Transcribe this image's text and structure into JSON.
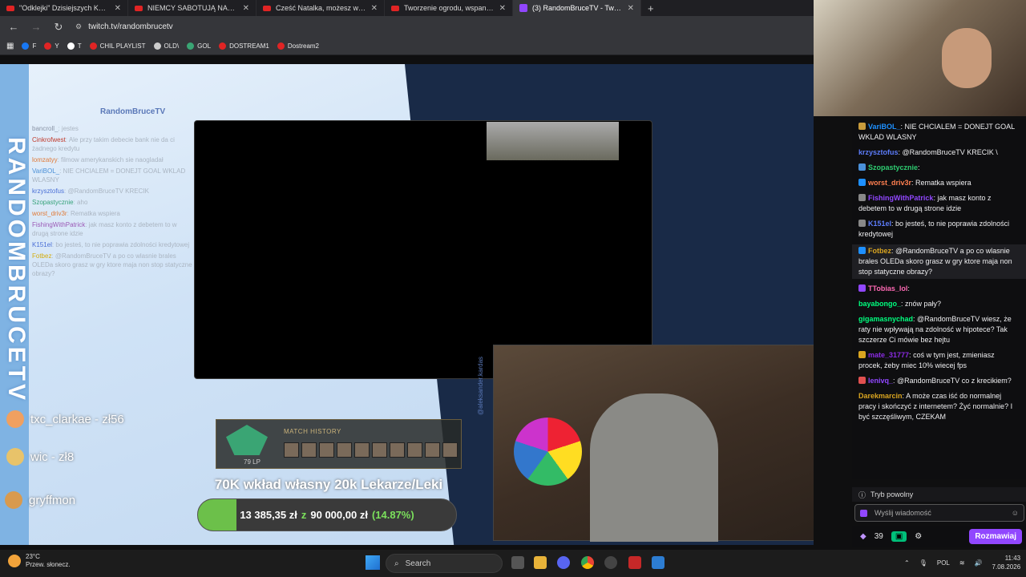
{
  "tabs": [
    {
      "title": "\"Odklejki\" Dzisiejszych Kobiet #",
      "icon": "youtube"
    },
    {
      "title": "NIEMCY SABOTUJĄ NASZE ZŁO",
      "icon": "youtube"
    },
    {
      "title": "Cześć Natalka, możesz wyjść -",
      "icon": "youtube"
    },
    {
      "title": "Tworzenie ogrodu, wspaniałe k",
      "icon": "youtube"
    },
    {
      "title": "(3) RandomBruceTV - Twitch",
      "icon": "twitch",
      "active": true
    }
  ],
  "address": {
    "url": "twitch.tv/randombrucetv"
  },
  "bookmarks": [
    "F",
    "Y",
    "T",
    "CHIL PLAYLIST",
    "OLD\\",
    "GOL",
    "DOSTREAM1",
    "Dostream2"
  ],
  "overlay": {
    "vertical_title": "RANDOMBRUCETV",
    "channel_name": "RandomBruceTV",
    "chat": [
      {
        "user": "bancroll_",
        "text": "jestes",
        "color": "#8a94a6"
      },
      {
        "user": "Cinkrofwest",
        "text": "Ale przy takim debecie bank nie da ci żadnego kredytu",
        "color": "#c0392b"
      },
      {
        "user": "lomzatyy",
        "text": "filmow amerykanskich sie naogladał",
        "color": "#e07b39"
      },
      {
        "user": "VariBOL_",
        "text": "NIE CHCIALEM = DONEJT GOAL WKLAD WLASNY",
        "color": "#4a8fd6"
      },
      {
        "user": "krzysztofus",
        "text": "@RandomBruceTV KRECIK",
        "color": "#4a6fd6"
      },
      {
        "user": "Szopastycznie",
        "text": "aho",
        "color": "#37a37a"
      },
      {
        "user": "worst_driv3r",
        "text": "Rematka wspiera",
        "color": "#e07b39"
      },
      {
        "user": "FishingWithPatrick",
        "text": "jak masz konto z debetem to w drugą strone idzie",
        "color": "#9b59b6"
      },
      {
        "user": "K151el",
        "text": "bo jesteś, to nie poprawia zdolności kredytowej",
        "color": "#4a6fd6"
      },
      {
        "user": "Fotbez",
        "text": "@RandomBruceTV a po co wlasnie brales OLEDa skoro grasz w gry ktore maja non stop statyczne obrazy?",
        "color": "#d4ac0d"
      }
    ],
    "donors": [
      "txc_clarkae - zł56",
      "wic - zł8",
      "gryffmon"
    ],
    "match_history": {
      "label": "MATCH HISTORY",
      "lp": "79 LP"
    },
    "goal": {
      "title": "70K wkład własny 20k Lekarze/Leki",
      "current": "13 385,35 zł",
      "z": "z",
      "target": "90 000,00 zł",
      "percent": "(14.87%)",
      "fraction": 0.1487
    },
    "credit": "@aleksander.kardas"
  },
  "chat": {
    "messages": [
      {
        "user": "VariBOL_",
        "text": "NIE CHCIALEM = DONEJT GOAL WKLAD WLASNY",
        "color": "#1e90ff",
        "badge": "#c89b3c"
      },
      {
        "user": "krzysztofus",
        "text": "@RandomBruceTV KRECIK \\",
        "color": "#5c7cfa",
        "badge": ""
      },
      {
        "user": "Szopastycznie",
        "text": "",
        "color": "#2ecc71",
        "badge": "#4a90d9"
      },
      {
        "user": "worst_driv3r",
        "text": "Rematka wspiera",
        "color": "#ff7f50",
        "badge": "#1e90ff"
      },
      {
        "user": "FishingWithPatrick",
        "text": "jak masz konto z debetem to w drugą strone idzie",
        "color": "#9147ff",
        "badge": "#888"
      },
      {
        "user": "K151el",
        "text": "bo jesteś, to nie poprawia zdolności kredytowej",
        "color": "#5c7cfa",
        "badge": "#888"
      },
      {
        "user": "Fotbez",
        "text": "@RandomBruceTV a po co wlasnie brales OLEDa skoro grasz w gry ktore maja non stop statyczne obrazy?",
        "color": "#daa520",
        "badge": "#1e90ff",
        "highlight": true
      },
      {
        "user": "TTobias_lol",
        "text": "",
        "color": "#ff69b4",
        "badge": "#9147ff"
      },
      {
        "user": "bayabongo_",
        "text": "znów pały?",
        "color": "#00ff7f",
        "badge": ""
      },
      {
        "user": "gigamasnychad",
        "text": "@RandomBruceTV wiesz, że raty nie wpływają na zdolność w hipotece? Tak szczerze Ci mówie bez hejtu",
        "color": "#00ff7f",
        "badge": ""
      },
      {
        "user": "mate_31777",
        "text": "coś w tym jest, zmieniasz procek, żeby miec 10% wiecej fps",
        "color": "#8a2be2",
        "badge": "#daa520"
      },
      {
        "user": "lenivq_",
        "text": "@RandomBruceTV co z krecikiem?",
        "color": "#9147ff",
        "badge": "#e05050"
      },
      {
        "user": "Darekmarcin",
        "text": "A może czas iść do normalnej pracy i skończyć z internetem? Żyć normalnie? I być szczęśliwym, CZEKAM",
        "color": "#daa520",
        "badge": ""
      }
    ],
    "slow_mode": "Tryb powolny",
    "send_placeholder": "Wyślij wiadomość",
    "points": "39",
    "chat_button": "Rozmawiaj"
  },
  "taskbar": {
    "temp": "23°C",
    "weather": "Przew. słonecz.",
    "search": "Search",
    "lang": "POL",
    "time": "11:43",
    "date": "7.08.2026"
  }
}
